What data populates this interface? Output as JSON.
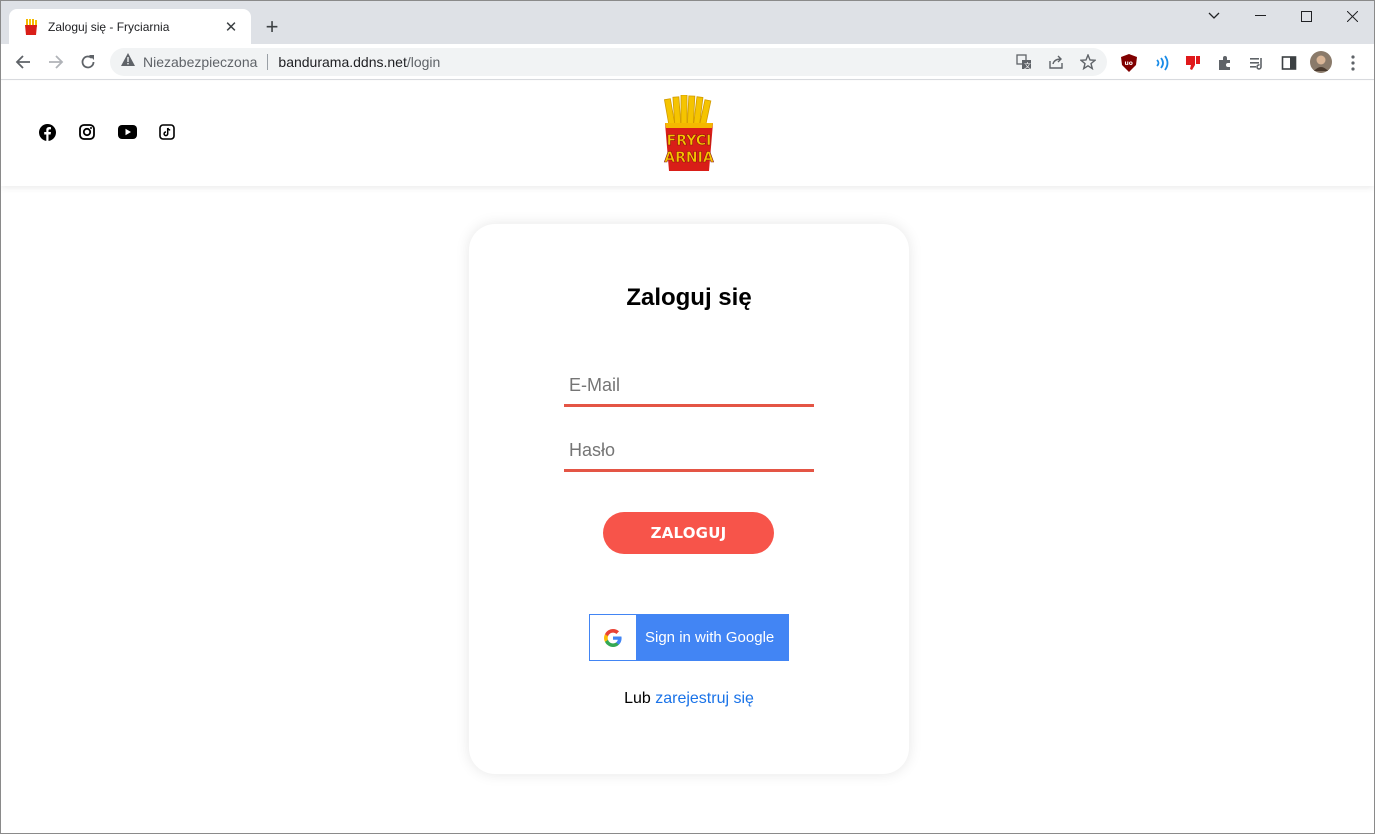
{
  "browser": {
    "tab_title": "Zaloguj się - Fryciarnia",
    "security_label": "Niezabezpieczona",
    "url_host": "bandurama.ddns.net",
    "url_path": "/login"
  },
  "site": {
    "logo_text_line1": "FRYCI",
    "logo_text_line2": "ARNIA",
    "social": [
      "facebook-icon",
      "instagram-icon",
      "youtube-icon",
      "tiktok-icon"
    ]
  },
  "login": {
    "title": "Zaloguj się",
    "email_placeholder": "E-Mail",
    "password_placeholder": "Hasło",
    "submit_label": "ZALOGUJ",
    "google_label": "Sign in with Google",
    "register_prefix": "Lub",
    "register_link": "zarejestruj się"
  },
  "colors": {
    "accent": "#f7544a",
    "field_underline": "#e45545",
    "google_blue": "#4285f4",
    "link": "#1a73e8"
  }
}
